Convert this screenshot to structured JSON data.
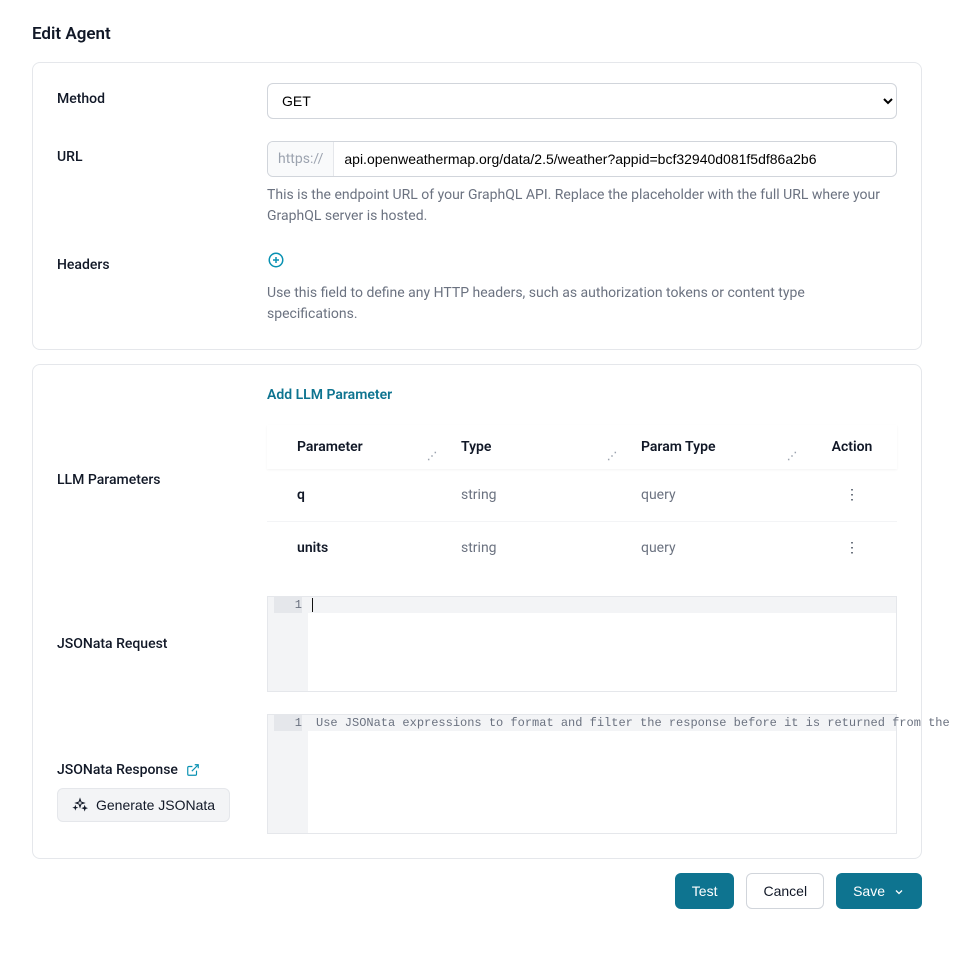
{
  "title": "Edit Agent",
  "method": {
    "label": "Method",
    "value": "GET"
  },
  "url": {
    "label": "URL",
    "prefix": "https://",
    "value": "api.openweathermap.org/data/2.5/weather?appid=bcf32940d081f5df86a2b6",
    "help": "This is the endpoint URL of your GraphQL API. Replace the placeholder with the full URL where your GraphQL server is hosted."
  },
  "headers": {
    "label": "Headers",
    "help": "Use this field to define any HTTP headers, such as authorization tokens or content type specifications."
  },
  "llm": {
    "add_link": "Add LLM Parameter",
    "label": "LLM Parameters",
    "columns": {
      "param": "Parameter",
      "type": "Type",
      "ptype": "Param Type",
      "action": "Action"
    },
    "rows": [
      {
        "param": "q",
        "type": "string",
        "ptype": "query"
      },
      {
        "param": "units",
        "type": "string",
        "ptype": "query"
      }
    ]
  },
  "jsonata_req": {
    "label": "JSONata Request",
    "line": "1"
  },
  "jsonata_res": {
    "label": "JSONata Response",
    "line": "1",
    "placeholder": "Use JSONata expressions to format and filter the response before it is returned from the agent.",
    "gen_button": "Generate JSONata"
  },
  "footer": {
    "test": "Test",
    "cancel": "Cancel",
    "save": "Save"
  }
}
